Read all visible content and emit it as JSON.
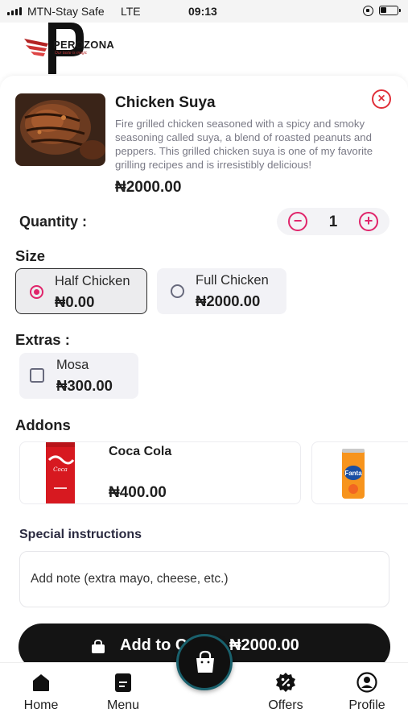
{
  "status_bar": {
    "carrier": "MTN-Stay Safe",
    "network": "LTE",
    "time": "09:13"
  },
  "brand": {
    "name": "PEROZONA",
    "tagline": "Our taste is magic",
    "accent_color": "#e0246a"
  },
  "item": {
    "title": "Chicken Suya",
    "description": "Fire grilled chicken seasoned with a spicy and smoky seasoning called suya, a blend of roasted peanuts and peppers. This grilled chicken suya is one of my favorite grilling recipes and is irresistibly delicious!",
    "price": "₦2000.00",
    "image_icon": "grilled-chicken-photo"
  },
  "quantity": {
    "label": "Quantity :",
    "value": "1",
    "minus_icon": "minus-circle-icon",
    "plus_icon": "plus-circle-icon"
  },
  "size": {
    "label": "Size",
    "options": [
      {
        "name": "Half Chicken",
        "price": "₦0.00",
        "selected": true
      },
      {
        "name": "Full Chicken",
        "price": "₦2000.00",
        "selected": false
      }
    ]
  },
  "extras": {
    "label": "Extras :",
    "options": [
      {
        "name": "Mosa",
        "price": "₦300.00",
        "checked": false
      }
    ]
  },
  "addons": {
    "label": "Addons",
    "items": [
      {
        "name": "Coca Cola",
        "price": "₦400.00",
        "icon": "coca-cola-can"
      },
      {
        "icon": "fanta-can"
      }
    ]
  },
  "special_instructions": {
    "label": "Special instructions",
    "placeholder": "Add note (extra mayo, cheese, etc.)"
  },
  "cart_button": {
    "label": "Add to C",
    "total": "₦2000.00"
  },
  "bottom_nav": {
    "items": [
      {
        "label": "Home",
        "icon": "home-icon",
        "active": true
      },
      {
        "label": "Menu",
        "icon": "menu-icon",
        "active": false
      },
      {
        "label": "Offers",
        "icon": "offers-icon",
        "active": false
      },
      {
        "label": "Profile",
        "icon": "profile-icon",
        "active": false
      }
    ],
    "center_icon": "shopping-bag-icon"
  }
}
